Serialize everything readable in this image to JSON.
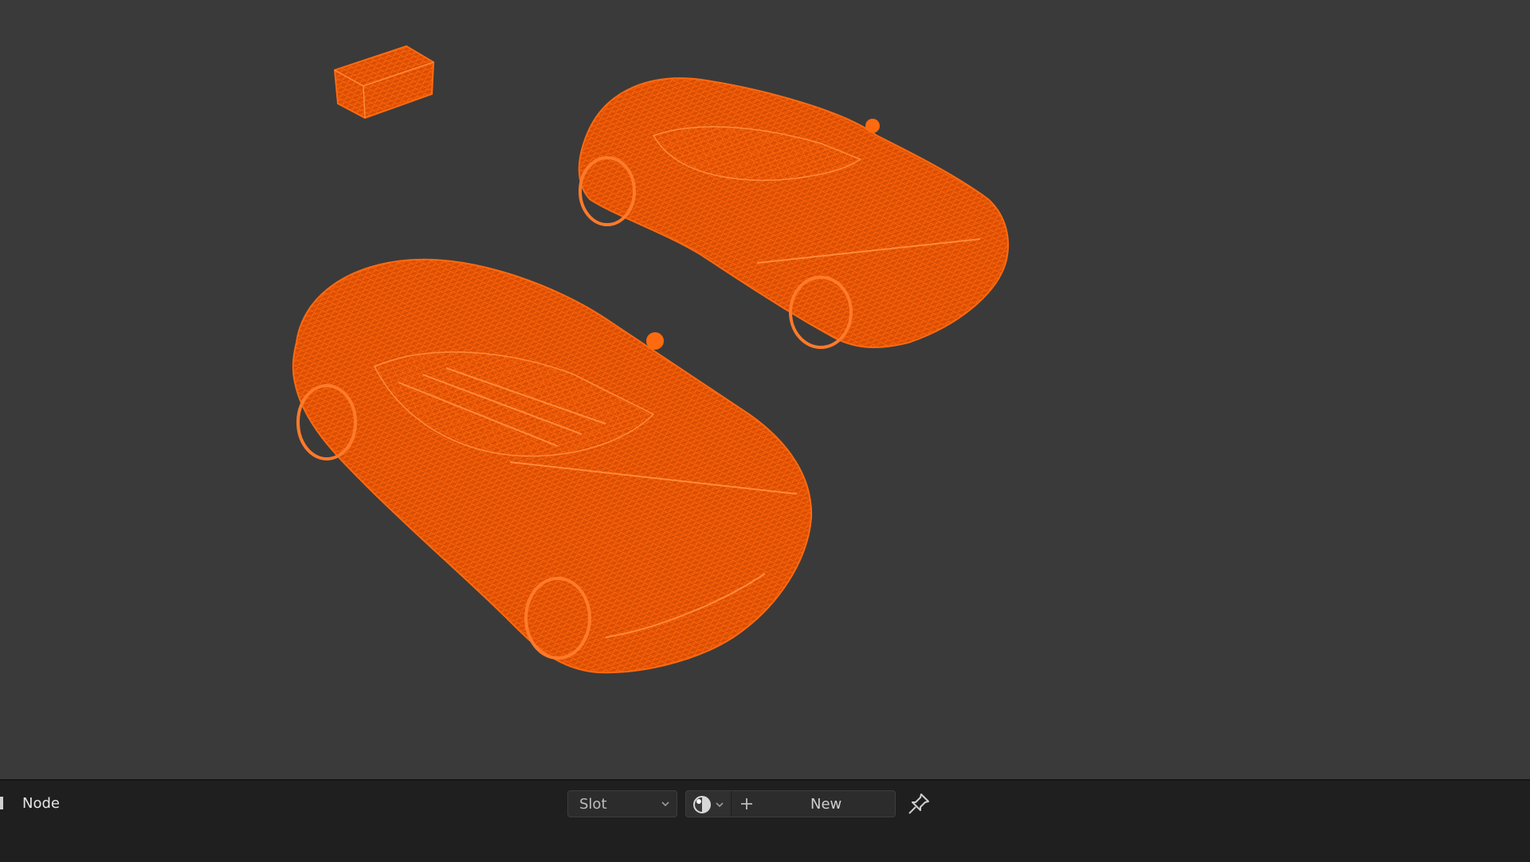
{
  "header": {
    "menu_node": "Node"
  },
  "material": {
    "slot_label": "Slot",
    "new_label": "New",
    "browse_icon": "material-sphere-icon",
    "new_icon": "plus-icon",
    "pin_icon": "pin-icon"
  },
  "colors": {
    "viewport_bg": "#3a3a3a",
    "wireframe": "#ff5a00",
    "header_bg": "#1f1f1f"
  }
}
